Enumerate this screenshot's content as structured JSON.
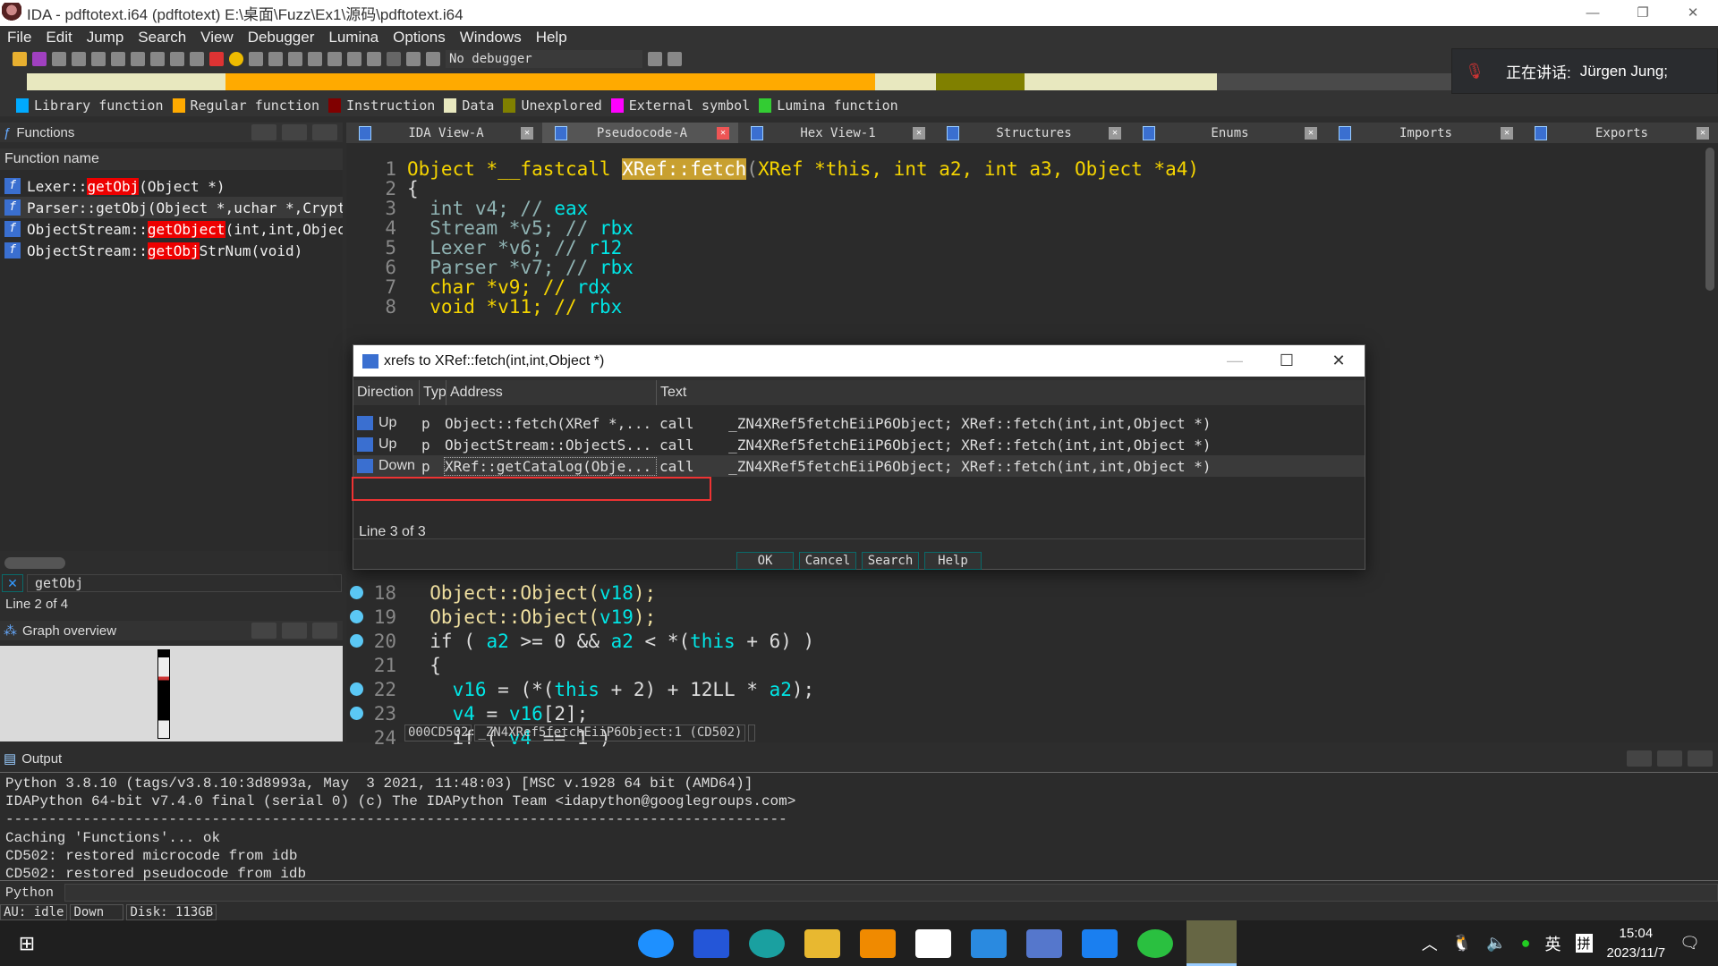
{
  "window": {
    "title": "IDA - pdftotext.i64 (pdftotext) E:\\桌面\\Fuzz\\Ex1\\源码\\pdftotext.i64"
  },
  "menu": [
    "File",
    "Edit",
    "Jump",
    "Search",
    "View",
    "Debugger",
    "Lumina",
    "Options",
    "Windows",
    "Help"
  ],
  "toolbar": {
    "debugger": "No debugger"
  },
  "speaking": {
    "label": "正在讲话:",
    "name": "Jürgen Jung;"
  },
  "legend": [
    {
      "label": "Library function",
      "color": "#00aaff"
    },
    {
      "label": "Regular function",
      "color": "#ffaa00"
    },
    {
      "label": "Instruction",
      "color": "#800000"
    },
    {
      "label": "Data",
      "color": "#e8e8bf"
    },
    {
      "label": "Unexplored",
      "color": "#808000"
    },
    {
      "label": "External symbol",
      "color": "#ff00ff"
    },
    {
      "label": "Lumina function",
      "color": "#33cc33"
    }
  ],
  "functions": {
    "title": "Functions",
    "column": "Function name",
    "rows": [
      {
        "pre": "Lexer::",
        "hl": "getObj",
        "post": "(Object *)"
      },
      {
        "pre": "Parser::getObj(Object *,uchar *,CryptAlgorithm,int,int,int,int)",
        "hl": "",
        "post": ""
      },
      {
        "pre": "ObjectStream::",
        "hl": "getObject",
        "post": "(int,int,Object *)"
      },
      {
        "pre": "ObjectStream::",
        "hl": "getObj",
        "post": "StrNum(void)"
      }
    ],
    "filter": "getObj",
    "status": "Line 2 of 4"
  },
  "graph": {
    "title": "Graph overview"
  },
  "tabs": [
    "IDA View-A",
    "Pseudocode-A",
    "Hex View-1",
    "Structures",
    "Enums",
    "Imports",
    "Exports"
  ],
  "code": {
    "lines": [
      {
        "n": "1",
        "t": [
          [
            "Object *__fastcall ",
            "y"
          ],
          [
            "XRef::fetch",
            "h"
          ],
          [
            "(",
            "s"
          ],
          [
            "XRef *this, int a2, int a3, Object *a4",
            "y"
          ],
          [
            ")",
            "y"
          ]
        ]
      },
      {
        "n": "2",
        "t": [
          [
            "{",
            "w"
          ]
        ]
      },
      {
        "n": "3",
        "t": [
          [
            "  int v4; // ",
            "g"
          ],
          [
            "eax",
            "c"
          ]
        ]
      },
      {
        "n": "4",
        "t": [
          [
            "  Stream *v5; // ",
            "g"
          ],
          [
            "rbx",
            "c"
          ]
        ]
      },
      {
        "n": "5",
        "t": [
          [
            "  Lexer *v6; // ",
            "g"
          ],
          [
            "r12",
            "c"
          ]
        ]
      },
      {
        "n": "6",
        "t": [
          [
            "  Parser *v7; // ",
            "g"
          ],
          [
            "rbx",
            "c"
          ]
        ]
      },
      {
        "n": "7",
        "t": [
          [
            "  char *v9; // ",
            "y"
          ],
          [
            "rdx",
            "c"
          ]
        ]
      },
      {
        "n": "8",
        "t": [
          [
            "  void *v11; // ",
            "y"
          ],
          [
            "rbx",
            "c"
          ]
        ]
      },
      {
        "n": "18",
        "bp": true,
        "t": [
          [
            "  Object::Object(",
            "f"
          ],
          [
            "v18",
            "c"
          ],
          [
            ");",
            "f"
          ]
        ]
      },
      {
        "n": "19",
        "bp": true,
        "t": [
          [
            "  Object::Object(",
            "f"
          ],
          [
            "v19",
            "c"
          ],
          [
            ");",
            "f"
          ]
        ]
      },
      {
        "n": "20",
        "bp": true,
        "t": [
          [
            "  if ( ",
            "w"
          ],
          [
            "a2",
            "c"
          ],
          [
            " >= 0 && ",
            "w"
          ],
          [
            "a2",
            "c"
          ],
          [
            " < *(",
            "w"
          ],
          [
            "this",
            "c"
          ],
          [
            " + 6) )",
            "w"
          ]
        ]
      },
      {
        "n": "21",
        "t": [
          [
            "  {",
            "w"
          ]
        ]
      },
      {
        "n": "22",
        "bp": true,
        "t": [
          [
            "    ",
            "w"
          ],
          [
            "v16",
            "c"
          ],
          [
            " = (*(",
            "w"
          ],
          [
            "this",
            "c"
          ],
          [
            " + 2) + 12LL * ",
            "w"
          ],
          [
            "a2",
            "c"
          ],
          [
            ");",
            "w"
          ]
        ]
      },
      {
        "n": "23",
        "bp": true,
        "t": [
          [
            "    ",
            "w"
          ],
          [
            "v4",
            "c"
          ],
          [
            " = ",
            "w"
          ],
          [
            "v16",
            "c"
          ],
          [
            "[2];",
            "w"
          ]
        ]
      },
      {
        "n": "24",
        "t": [
          [
            "    if ( ",
            "w"
          ],
          [
            "v4",
            "c"
          ],
          [
            " == 1 )",
            "w"
          ]
        ]
      }
    ],
    "status": [
      "000CD502",
      "_ZN4XRef5fetchEiiP6Object:1 (CD502)",
      ""
    ]
  },
  "dialog": {
    "title": "xrefs to XRef::fetch(int,int,Object *)",
    "columns": [
      "Direction",
      "Typ",
      "Address",
      "Text"
    ],
    "rows": [
      {
        "dir": "Up",
        "typ": "p",
        "addr": "Object::fetch(XRef *,...",
        "text": "call    _ZN4XRef5fetchEiiP6Object; XRef::fetch(int,int,Object *)"
      },
      {
        "dir": "Up",
        "typ": "p",
        "addr": "ObjectStream::ObjectS...",
        "text": "call    _ZN4XRef5fetchEiiP6Object; XRef::fetch(int,int,Object *)"
      },
      {
        "dir": "Down",
        "typ": "p",
        "addr": "XRef::getCatalog(Obje...",
        "text": "call    _ZN4XRef5fetchEiiP6Object; XRef::fetch(int,int,Object *)"
      }
    ],
    "status": "Line 3 of 3",
    "buttons": [
      "OK",
      "Cancel",
      "Search",
      "Help"
    ]
  },
  "output": {
    "title": "Output",
    "lines": [
      "Python 3.8.10 (tags/v3.8.10:3d8993a, May  3 2021, 11:48:03) [MSC v.1928 64 bit (AMD64)]",
      "IDAPython 64-bit v7.4.0 final (serial 0) (c) The IDAPython Team <idapython@googlegroups.com>",
      "-------------------------------------------------------------------------------------------",
      "Caching 'Functions'... ok",
      "CD502: restored microcode from idb",
      "CD502: restored pseudocode from idb"
    ],
    "lang": "Python"
  },
  "statusbar": [
    "AU:  idle",
    "Down",
    "Disk: 113GB"
  ],
  "taskbar": {
    "time": "15:04",
    "date": "2023/11/7",
    "ime": "英",
    "ime2": "拼"
  }
}
